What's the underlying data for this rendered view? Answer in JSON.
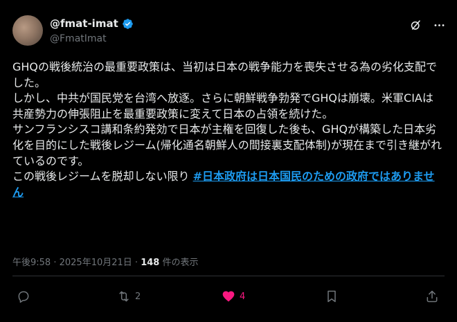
{
  "author": {
    "display_name": "@fmat-imat",
    "handle": "@FmatImat",
    "verified": true
  },
  "tweet": {
    "text": "GHQの戦後統治の最重要政策は、当初は日本の戦争能力を喪失させる為の劣化支配でした。\nしかし、中共が国民党を台湾へ放逐。さらに朝鮮戦争勃発でGHQは崩壊。米軍CIAは共産勢力の伸張阻止を最重要政策に変えて日本の占領を続けた。\nサンフランシスコ講和条約発効で日本が主権を回復した後も、GHQが構築した日本劣化を目的にした戦後レジーム(帰化通名朝鮮人の間接裏支配体制)が現在まで引き継がれているのです。\nこの戦後レジームを脱却しない限り ",
    "hashtag": "#日本政府は日本国民のための政府ではありません"
  },
  "meta": {
    "time": "午後9:58",
    "separator": " · ",
    "date": "2025年10月21日",
    "views_sep": " · ",
    "views_count": "148",
    "views_label": " 件の表示"
  },
  "actions": {
    "retweet_count": "2",
    "like_count": "4"
  },
  "colors": {
    "background": "#000000",
    "text": "#e7e9ea",
    "muted": "#71767b",
    "link": "#1d9bf0",
    "like": "#f91880",
    "verified": "#1d9bf0"
  }
}
